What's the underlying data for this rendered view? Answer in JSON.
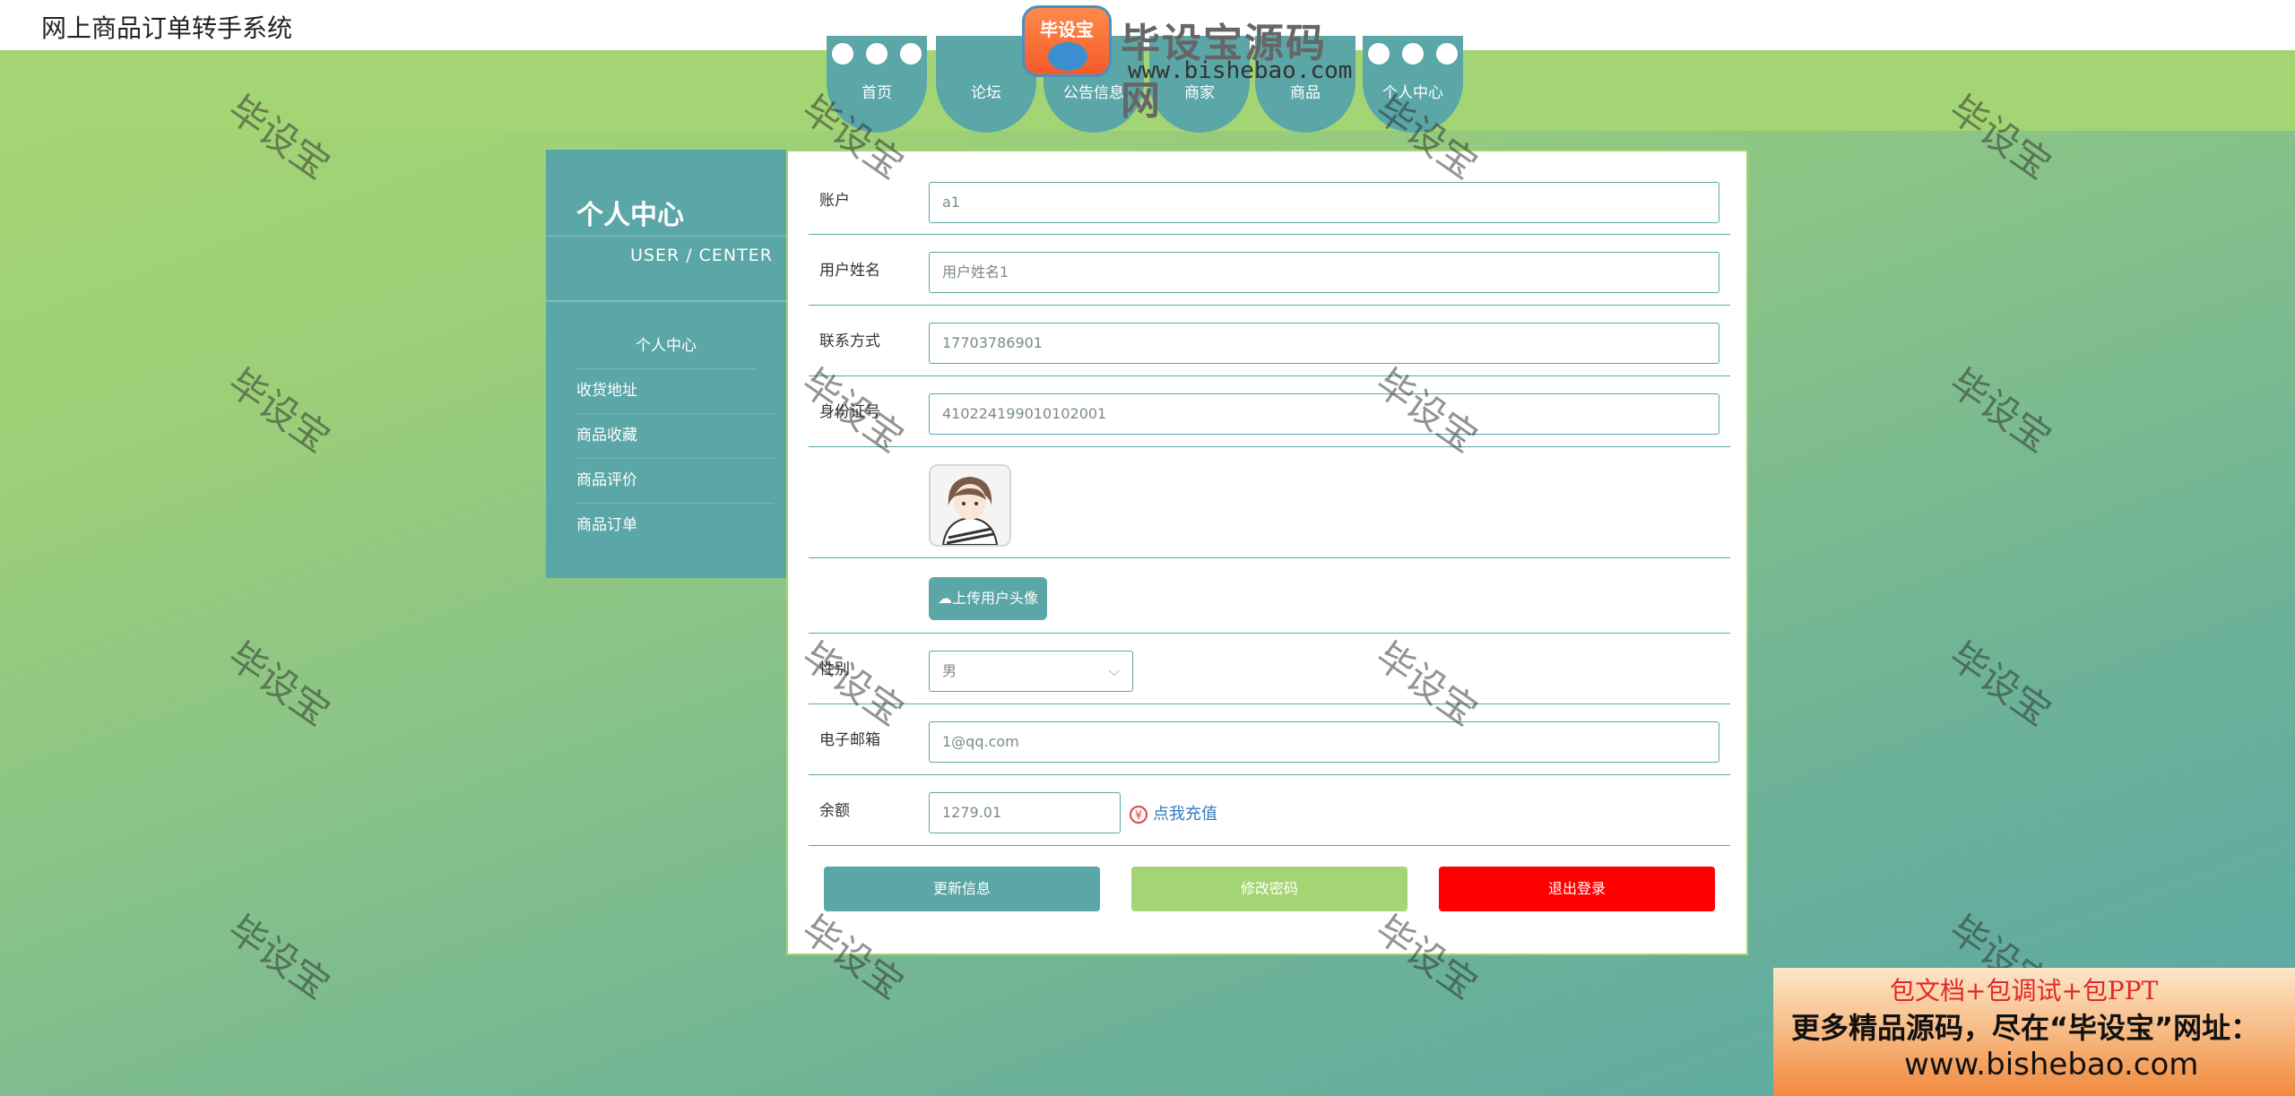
{
  "site": {
    "title": "网上商品订单转手系统"
  },
  "logo": {
    "badge": "毕设宝",
    "name": "毕设宝源码网",
    "url": "www.bishebao.com"
  },
  "nav": [
    {
      "label": "首页"
    },
    {
      "label": "论坛"
    },
    {
      "label": "公告信息"
    },
    {
      "label": "商家"
    },
    {
      "label": "商品"
    },
    {
      "label": "个人中心"
    }
  ],
  "sidebar": {
    "title": "个人中心",
    "subtitle": "USER / CENTER",
    "items": [
      {
        "label": "个人中心"
      },
      {
        "label": "收货地址"
      },
      {
        "label": "商品收藏"
      },
      {
        "label": "商品评价"
      },
      {
        "label": "商品订单"
      }
    ]
  },
  "form": {
    "account_label": "账户",
    "account_value": "a1",
    "username_label": "用户姓名",
    "username_value": "用户姓名1",
    "phone_label": "联系方式",
    "phone_value": "17703786901",
    "idcard_label": "身份证号",
    "idcard_value": "410224199010102001",
    "upload_label": "上传用户头像",
    "gender_label": "性别",
    "gender_value": "男",
    "email_label": "电子邮箱",
    "email_value": "1@qq.com",
    "balance_label": "余额",
    "balance_value": "1279.01",
    "recharge_label": "点我充值",
    "update_button": "更新信息",
    "password_button": "修改密码",
    "logout_button": "退出登录"
  },
  "watermark": "毕设宝",
  "promo": {
    "line1": "包文档+包调试+包PPT",
    "line2": "更多精品源码，尽在“毕设宝”网址：",
    "line3": "www.bishebao.com"
  },
  "colors": {
    "teal": "#5ba6a6",
    "green": "#a4d574",
    "red": "#ff0000"
  }
}
